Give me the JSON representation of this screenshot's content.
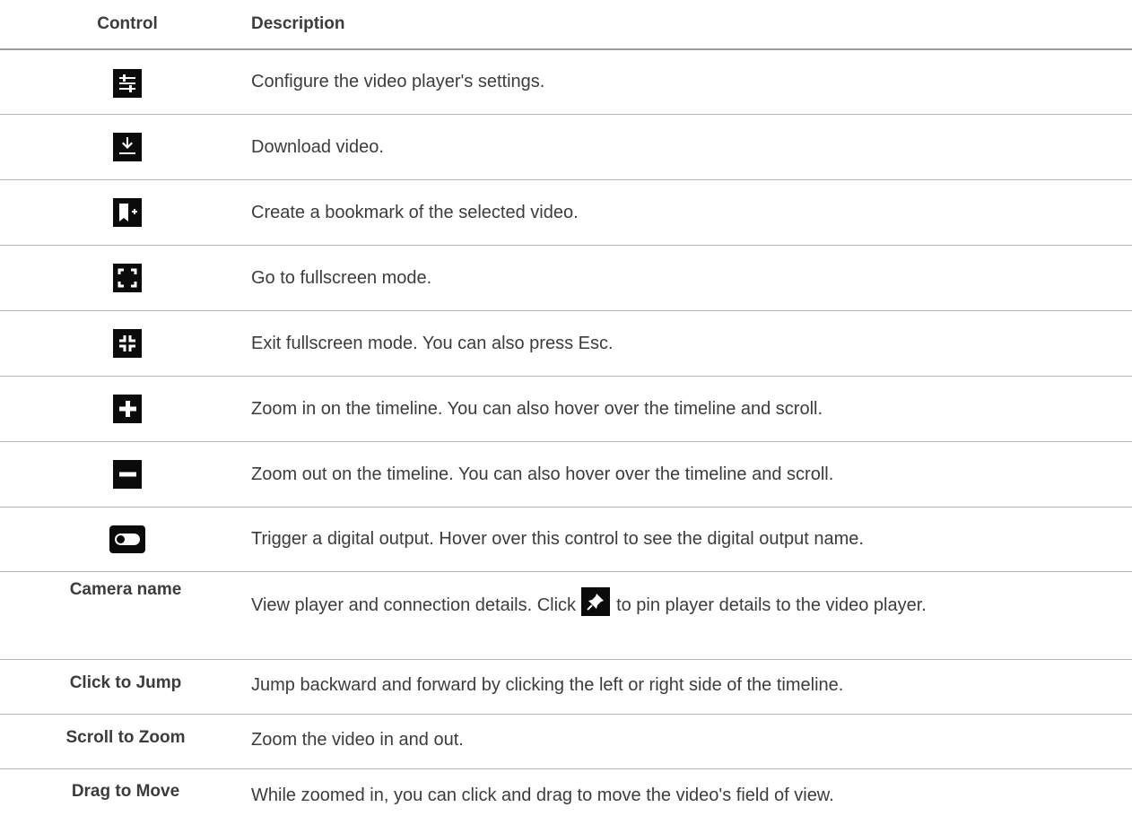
{
  "header": {
    "control": "Control",
    "description": "Description"
  },
  "rows": [
    {
      "icon": "sliders-icon",
      "description": "Configure the video player's settings."
    },
    {
      "icon": "download-icon",
      "description": "Download video."
    },
    {
      "icon": "bookmark-add-icon",
      "description": "Create a bookmark of the selected video."
    },
    {
      "icon": "fullscreen-icon",
      "description": "Go to fullscreen mode."
    },
    {
      "icon": "exit-fullscreen-icon",
      "description": "Exit fullscreen mode. You can also press Esc."
    },
    {
      "icon": "plus-icon",
      "description": "Zoom in on the timeline. You can also hover over the timeline and scroll."
    },
    {
      "icon": "minus-icon",
      "description": "Zoom out on the timeline. You can also hover over the timeline and scroll."
    },
    {
      "icon": "toggle-icon",
      "description": "Trigger a digital output. Hover over this control to see the digital output name."
    },
    {
      "control": "Camera name",
      "description_before": "View player and connection details. Click",
      "icon": "pin-icon",
      "description_after": "to pin player details to the video player."
    },
    {
      "control": "Click to Jump",
      "description": "Jump backward and forward by clicking the left or right side of the timeline."
    },
    {
      "control": "Scroll to Zoom",
      "description": "Zoom the video in and out."
    },
    {
      "control": "Drag to Move",
      "description": "While zoomed in, you can click and drag to move the video's field of view."
    }
  ]
}
